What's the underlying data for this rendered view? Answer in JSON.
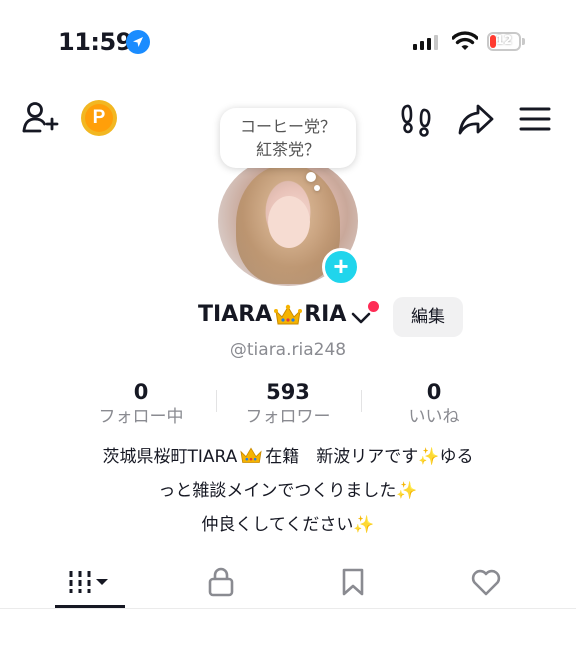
{
  "status_bar": {
    "time": "11:59",
    "battery": "12",
    "icons": [
      "location-arrow-icon",
      "cellular-signal-icon",
      "wifi-icon",
      "battery-icon"
    ]
  },
  "top_bar": {
    "icons": [
      "add-user-icon",
      "points-icon",
      "footprints-icon",
      "share-icon",
      "menu-icon"
    ],
    "points_letter": "P"
  },
  "note_bubble": {
    "line1": "コーヒー党？",
    "line2": "紅茶党？"
  },
  "profile": {
    "name_part1": "TIARA",
    "name_part2": "RIA",
    "edit_label": "編集",
    "handle": "@tiara.ria248"
  },
  "stats": [
    {
      "value": "0",
      "label": "フォロー中"
    },
    {
      "value": "593",
      "label": "フォロワー"
    },
    {
      "value": "0",
      "label": "いいね"
    }
  ],
  "bio": {
    "line1_a": "茨城県桜町TIARA",
    "line1_b": "在籍　新波リアです",
    "line1_c": "ゆる",
    "line2": "っと雑談メインでつくりました",
    "line3": "仲良くしてください"
  },
  "tabs": [
    {
      "name": "videos",
      "icon": "grid-icon",
      "active": true
    },
    {
      "name": "private",
      "icon": "lock-icon",
      "active": false
    },
    {
      "name": "saved",
      "icon": "bookmark-icon",
      "active": false
    },
    {
      "name": "liked",
      "icon": "heart-icon",
      "active": false
    }
  ],
  "colors": {
    "accent_cyan": "#20d5ec",
    "notification_red": "#fe2c55",
    "points_orange": "#ff9f0a",
    "location_blue": "#1a8cff"
  }
}
